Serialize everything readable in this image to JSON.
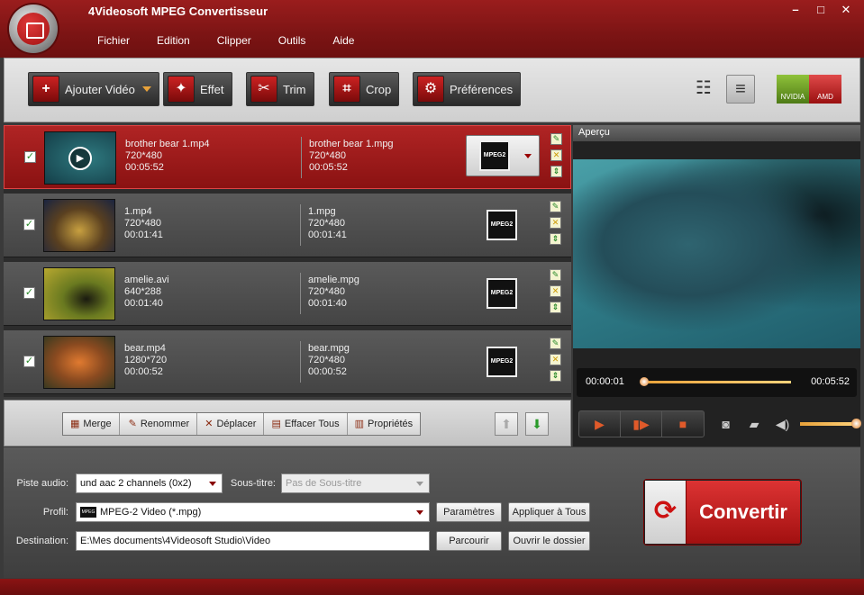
{
  "app": {
    "title": "4Videosoft MPEG Convertisseur"
  },
  "window_controls": {
    "minimize": "–",
    "maximize": "□",
    "close": "✕"
  },
  "menu": [
    "Fichier",
    "Edition",
    "Clipper",
    "Outils",
    "Aide"
  ],
  "toolbar": {
    "add_video": "Ajouter Vidéo",
    "effect": "Effet",
    "trim": "Trim",
    "crop": "Crop",
    "preferences": "Préférences",
    "gpu_nvidia": "NVIDIA",
    "gpu_amd": "AMD"
  },
  "files": [
    {
      "src_name": "brother bear 1.mp4",
      "src_res": "720*480",
      "src_dur": "00:05:52",
      "dst_name": "brother bear 1.mpg",
      "dst_res": "720*480",
      "dst_dur": "00:05:52",
      "format": "MPEG2",
      "checked": true,
      "selected": true
    },
    {
      "src_name": "1.mp4",
      "src_res": "720*480",
      "src_dur": "00:01:41",
      "dst_name": "1.mpg",
      "dst_res": "720*480",
      "dst_dur": "00:01:41",
      "format": "MPEG2",
      "checked": true,
      "selected": false
    },
    {
      "src_name": "amelie.avi",
      "src_res": "640*288",
      "src_dur": "00:01:40",
      "dst_name": "amelie.mpg",
      "dst_res": "720*480",
      "dst_dur": "00:01:40",
      "format": "MPEG2",
      "checked": true,
      "selected": false
    },
    {
      "src_name": "bear.mp4",
      "src_res": "1280*720",
      "src_dur": "00:00:52",
      "dst_name": "bear.mpg",
      "dst_res": "720*480",
      "dst_dur": "00:00:52",
      "format": "MPEG2",
      "checked": true,
      "selected": false
    }
  ],
  "listbar": {
    "merge": "Merge",
    "rename": "Renommer",
    "move": "Déplacer",
    "clear_all": "Effacer Tous",
    "properties": "Propriétés"
  },
  "preview": {
    "header": "Aperçu",
    "current_time": "00:00:01",
    "total_time": "00:05:52",
    "progress": 0.003,
    "volume": 1.0
  },
  "settings": {
    "audio_track_label": "Piste audio:",
    "audio_track_value": "und aac 2 channels (0x2)",
    "subtitle_label": "Sous-titre:",
    "subtitle_value": "Pas de Sous-titre",
    "profile_label": "Profil:",
    "profile_value": "MPEG-2 Video (*.mpg)",
    "destination_label": "Destination:",
    "destination_value": "E:\\Mes documents\\4Videosoft Studio\\Video",
    "params_button": "Paramètres",
    "apply_all_button": "Appliquer à Tous",
    "browse_button": "Parcourir",
    "open_folder_button": "Ouvrir le dossier",
    "convert_button": "Convertir"
  },
  "colors": {
    "brand_red": "#9a1d1d",
    "accent_orange": "#e8a23a",
    "convert_red": "#c81c1c"
  }
}
